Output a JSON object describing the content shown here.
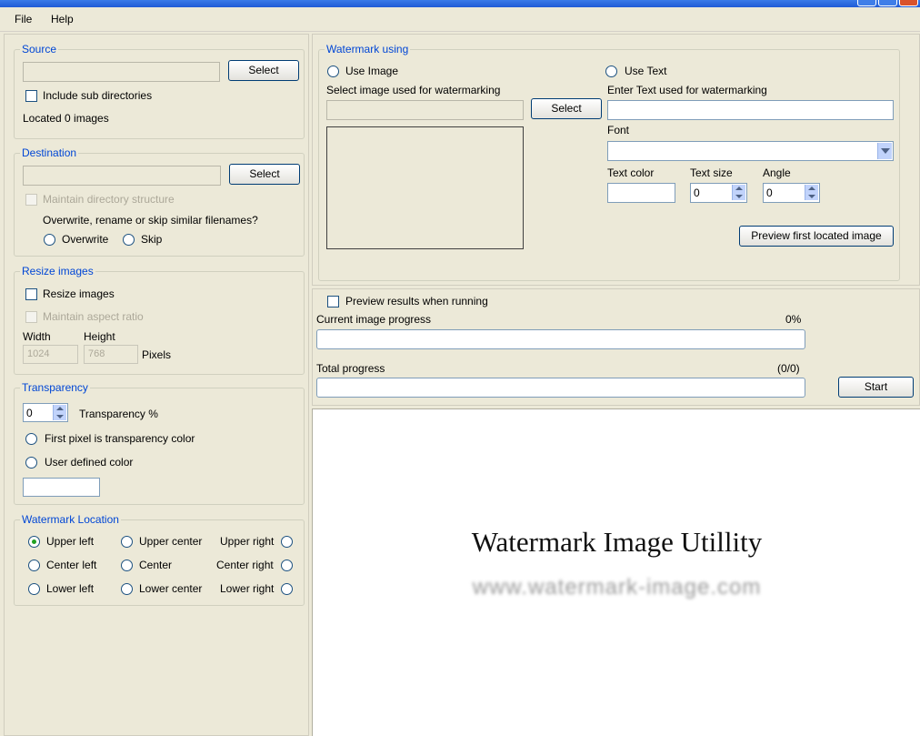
{
  "menu": {
    "file": "File",
    "help": "Help"
  },
  "source": {
    "title": "Source",
    "select_label": "Select",
    "include_subdirs_label": "Include sub directories",
    "located_text": "Located 0 images"
  },
  "destination": {
    "title": "Destination",
    "select_label": "Select",
    "maintain_structure_label": "Maintain directory structure",
    "overwrite_question": "Overwrite, rename or skip similar filenames?",
    "overwrite_label": "Overwrite",
    "skip_label": "Skip"
  },
  "resize": {
    "title": "Resize images",
    "resize_label": "Resize images",
    "aspect_label": "Maintain aspect ratio",
    "width_label": "Width",
    "height_label": "Height",
    "width_value": "1024",
    "height_value": "768",
    "pixels_label": "Pixels"
  },
  "transparency": {
    "title": "Transparency",
    "value": "0",
    "percent_label": "Transparency %",
    "first_pixel_label": "First pixel is transparency color",
    "user_defined_label": "User defined color"
  },
  "location": {
    "title": "Watermark Location",
    "upper_left": "Upper left",
    "upper_center": "Upper center",
    "upper_right": "Upper right",
    "center_left": "Center left",
    "center": "Center",
    "center_right": "Center right",
    "lower_left": "Lower left",
    "lower_center": "Lower center",
    "lower_right": "Lower right",
    "selected": "Upper left"
  },
  "watermark": {
    "title": "Watermark using",
    "use_image_label": "Use Image",
    "select_image_label": "Select image used for watermarking",
    "select_label": "Select",
    "use_text_label": "Use Text",
    "enter_text_label": "Enter Text used for watermarking",
    "font_label": "Font",
    "text_color_label": "Text color",
    "text_size_label": "Text size",
    "angle_label": "Angle",
    "text_size_value": "0",
    "angle_value": "0",
    "preview_first_label": "Preview first located image"
  },
  "progress": {
    "preview_results_label": "Preview results when running",
    "current_label": "Current image progress",
    "current_percent": "0%",
    "current_fraction": 0,
    "total_label": "Total progress",
    "total_count": "(0/0)",
    "total_fraction": 0,
    "start_label": "Start"
  },
  "preview": {
    "title": "Watermark Image Utillity",
    "url": "www.watermark-image.com"
  },
  "colors": {
    "group_label": "#0046d5",
    "window_bg": "#ece9d8",
    "radio_dot": "#21a121"
  }
}
